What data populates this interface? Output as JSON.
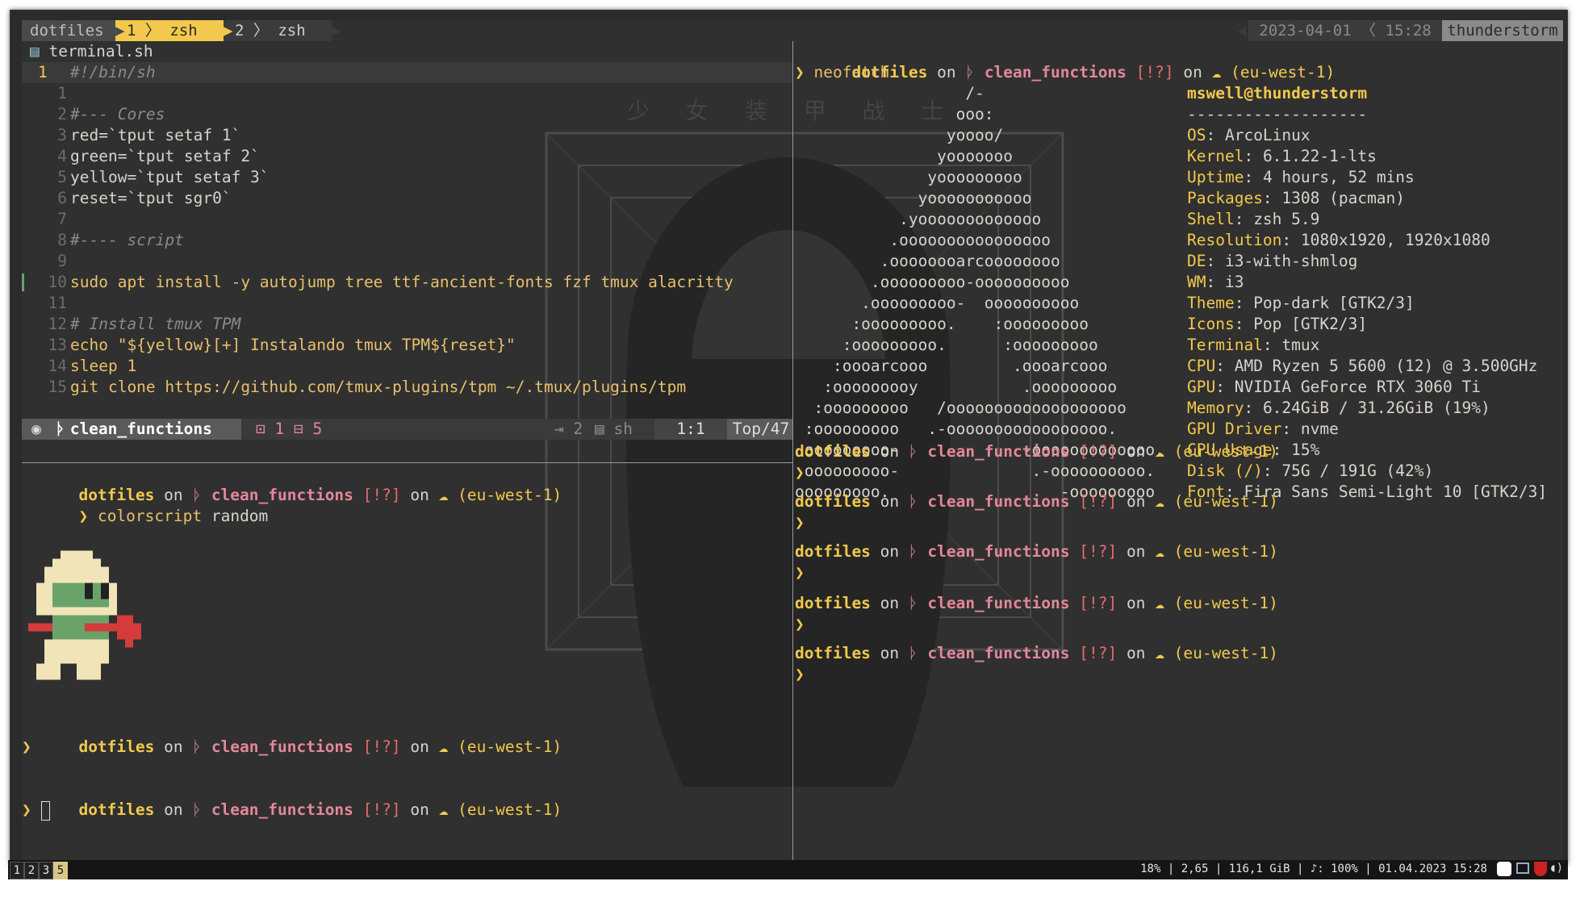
{
  "tmux": {
    "session": "dotfiles",
    "win1_index": "1",
    "win1_name": "zsh",
    "win2_index": "2",
    "win2_name": "zsh",
    "date": "2023-04-01",
    "time": "15:28",
    "host": "thunderstorm"
  },
  "editor": {
    "filename": "terminal.sh",
    "lines": [
      {
        "n": "1",
        "text": "#!/bin/sh"
      },
      {
        "n": "1",
        "text": ""
      },
      {
        "n": "2",
        "text": "#--- Cores"
      },
      {
        "n": "3",
        "text": "red=`tput setaf 1`"
      },
      {
        "n": "4",
        "text": "green=`tput setaf 2`"
      },
      {
        "n": "5",
        "text": "yellow=`tput setaf 3`"
      },
      {
        "n": "6",
        "text": "reset=`tput sgr0`"
      },
      {
        "n": "7",
        "text": ""
      },
      {
        "n": "8",
        "text": "#---- script"
      },
      {
        "n": "9",
        "text": ""
      },
      {
        "n": "10",
        "text": "sudo apt install -y autojump tree ttf-ancient-fonts fzf tmux alacritty"
      },
      {
        "n": "11",
        "text": ""
      },
      {
        "n": "12",
        "text": "# Install tmux TPM"
      },
      {
        "n": "13",
        "text": "echo \"${yellow}[+] Instalando tmux TPM${reset}\""
      },
      {
        "n": "14",
        "text": "sleep 1"
      },
      {
        "n": "15",
        "text": "git clone https://github.com/tmux-plugins/tpm ~/.tmux/plugins/tpm"
      }
    ],
    "status": {
      "branch": "clean_functions",
      "errors": "1",
      "warnings": "5",
      "indent": "2",
      "filetype": "sh",
      "pos": "1:1",
      "scroll": "Top/47"
    }
  },
  "prompt": {
    "dir": "dotfiles",
    "on": "on",
    "branch": "clean_functions",
    "status": "[!?]",
    "on2": "on",
    "region": "(eu-west-1)",
    "chevron": "❯"
  },
  "left_pane": {
    "command": "colorscript",
    "command_arg": "random"
  },
  "right_pane": {
    "command": "neofetch",
    "user_host": "mswell@thunderstorm",
    "separator": "-------------------",
    "info": [
      {
        "key": "OS",
        "value": "ArcoLinux"
      },
      {
        "key": "Kernel",
        "value": "6.1.22-1-lts"
      },
      {
        "key": "Uptime",
        "value": "4 hours, 52 mins"
      },
      {
        "key": "Packages",
        "value": "1308 (pacman)"
      },
      {
        "key": "Shell",
        "value": "zsh 5.9"
      },
      {
        "key": "Resolution",
        "value": "1080x1920, 1920x1080"
      },
      {
        "key": "DE",
        "value": "i3-with-shmlog"
      },
      {
        "key": "WM",
        "value": "i3"
      },
      {
        "key": "Theme",
        "value": "Pop-dark [GTK2/3]"
      },
      {
        "key": "Icons",
        "value": "Pop [GTK2/3]"
      },
      {
        "key": "Terminal",
        "value": "tmux"
      },
      {
        "key": "CPU",
        "value": "AMD Ryzen 5 5600 (12) @ 3.500GHz"
      },
      {
        "key": "GPU",
        "value": "NVIDIA GeForce RTX 3060 Ti"
      },
      {
        "key": "Memory",
        "value": "6.24GiB / 31.26GiB (19%)"
      },
      {
        "key": "GPU Driver",
        "value": "nvme"
      },
      {
        "key": "CPU Usage",
        "value": "15%"
      },
      {
        "key": "Disk (/)",
        "value": "75G / 191G (42%)"
      },
      {
        "key": "Font",
        "value": "Fira Sans Semi-Light 10 [GTK2/3]"
      }
    ],
    "ascii": [
      "                  /-",
      "                 ooo:",
      "                yoooo/",
      "               yooooooo",
      "              yooooooooo",
      "             yooooooooooo",
      "           .yooooooooooooo",
      "          .oooooooooooooooo",
      "         .oooooooarcoooooooo",
      "        .ooooooooo-oooooooooo",
      "       .ooooooooo-  oooooooooo",
      "      :ooooooooo.    :ooooooooo",
      "     :ooooooooo.      :ooooooooo",
      "    :oooarcooo         .oooarcooo",
      "   :ooooooooy           .ooooooooo",
      "  :ooooooooo   /ooooooooooooooooooo",
      " :ooooooooo   .-ooooooooooooooooo.",
      " ooooooooo-             -ooooooooooooo.",
      " ooooooooo-              .-oooooooooo.",
      "ooooooooo.                  -ooooooooo"
    ]
  },
  "bg_text": "少 女 装 甲 战 士",
  "i3bar": {
    "workspaces": [
      "1",
      "2",
      "3",
      "5"
    ],
    "active": "5",
    "status": "18% | 2,65 | 116,1 GiB | ♪: 100% | 01.04.2023 15:28"
  },
  "colors": {
    "bg": "#303030",
    "yellow": "#f2c94c",
    "pink": "#e3879b",
    "red": "#e76b6b",
    "statusbar": "#d9c78a"
  }
}
